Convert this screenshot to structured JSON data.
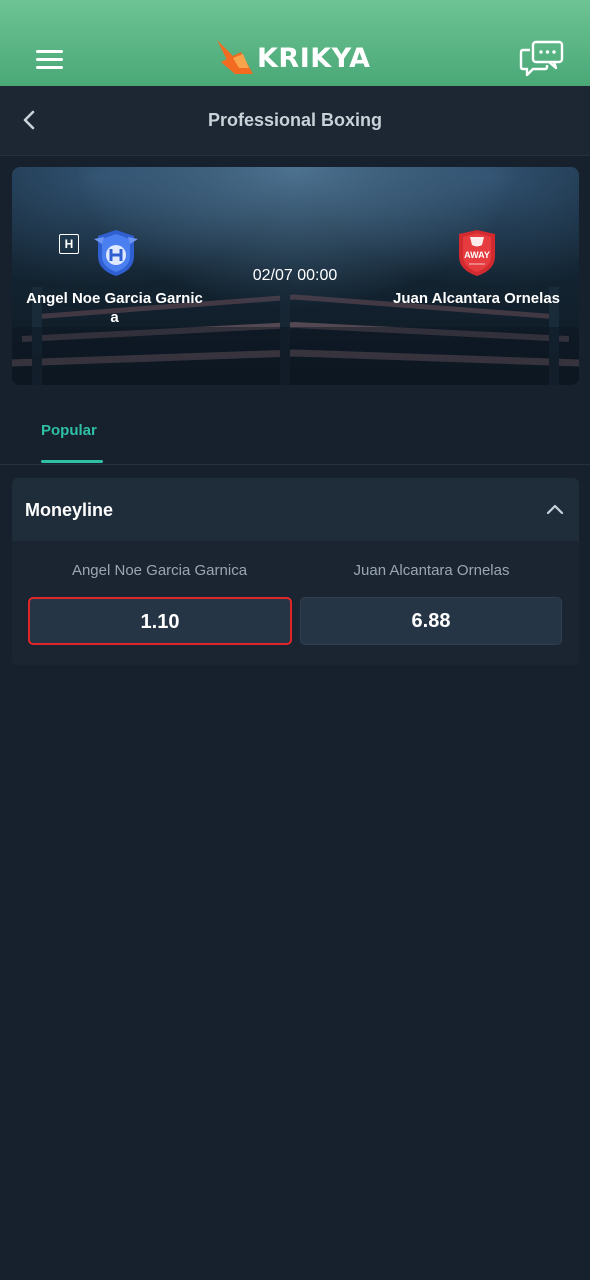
{
  "brand": {
    "name": "KRIKYA",
    "colors": {
      "header_green": "#6dc394",
      "logo_orange": "#f26b21",
      "accent_teal": "#2fbfa5",
      "selected_red": "#e0262b",
      "background": "#17212d"
    }
  },
  "header": {
    "menu_icon": "hamburger-menu-icon",
    "chat_icon": "chat-bubbles-icon"
  },
  "subheader": {
    "back_icon": "chevron-left-icon",
    "title": "Professional Boxing"
  },
  "match": {
    "home": {
      "tag": "H",
      "name": "Angel Noe Garcia Garnica",
      "logo_icon": "home-team-shield-icon"
    },
    "away": {
      "name": "Juan Alcantara Ornelas",
      "logo_icon": "away-team-shield-icon",
      "logo_text": "AWAY"
    },
    "datetime": "02/07 00:00"
  },
  "tabs": [
    {
      "label": "Popular",
      "active": true
    }
  ],
  "market": {
    "title": "Moneyline",
    "collapse_icon": "chevron-up-icon",
    "selections": [
      {
        "label": "Angel Noe Garcia Garnica",
        "odds": "1.10",
        "selected": true
      },
      {
        "label": "Juan Alcantara Ornelas",
        "odds": "6.88",
        "selected": false
      }
    ]
  }
}
